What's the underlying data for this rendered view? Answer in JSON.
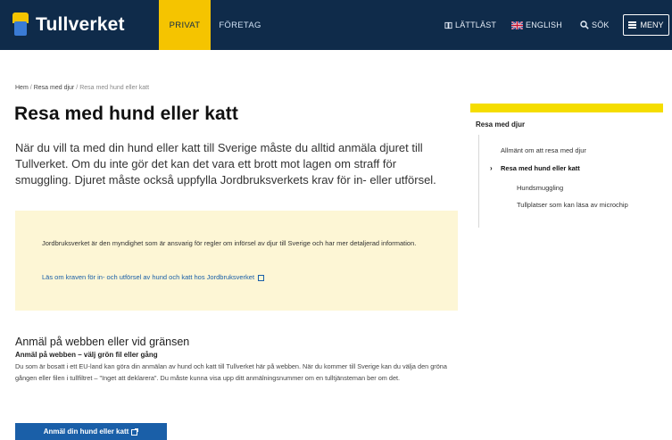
{
  "header": {
    "logo_text": "Tullverket",
    "tabs": [
      {
        "label": "PRIVAT",
        "active": true
      },
      {
        "label": "FÖRETAG",
        "active": false
      }
    ],
    "utilities": {
      "lattlast": "LÄTTLÄST",
      "english": "ENGLISH",
      "sok": "SÖK",
      "meny": "MENY"
    },
    "colors": {
      "background": "#0f2b4a",
      "active_tab": "#f5c400"
    }
  },
  "breadcrumb": {
    "items": [
      "Hem",
      "Resa med djur",
      "Resa med hund eller katt"
    ]
  },
  "page_title": "Resa med hund eller katt",
  "lead": "När du vill ta med din hund eller katt till Sverige måste du alltid anmäla djuret till Tullverket. Om du inte gör det kan det vara ett brott mot lagen om straff för smuggling. Djuret måste också uppfylla Jordbruksverkets krav för in- eller utförsel.",
  "infobox": {
    "text": "Jordbruksverket är den myndighet som är ansvarig för regler om införsel av djur till Sverige och har mer detaljerad information.",
    "link": "Läs om kraven för in- och utförsel av hund och katt hos Jordbruksverket",
    "background": "#fdf6d5"
  },
  "section": {
    "heading": "Anmäl på webben eller vid gränsen",
    "subheading": "Anmäl på webben – välj grön fil eller gång",
    "body": "Du som är bosatt i ett EU-land kan göra din anmälan av hund och katt till Tullverket här på webben. När du kommer till Sverige kan du välja den gröna gången eller filen i tullfiltret – \"Inget att deklarera\". Du måste kunna visa upp ditt anmälningsnummer om en tulltjänsteman ber om det.",
    "cta": "Anmäl din hund eller katt",
    "cta_color": "#1a5fa8"
  },
  "sidebar": {
    "title": "Resa med djur",
    "items": [
      {
        "label": "Allmänt om att resa med djur",
        "active": false
      },
      {
        "label": "Resa med hund eller katt",
        "active": true
      },
      {
        "label": "Hundsmuggling",
        "active": false
      },
      {
        "label": "Tullplatser som kan läsa av microchip",
        "active": false
      }
    ],
    "accent": "#f5dd00"
  }
}
